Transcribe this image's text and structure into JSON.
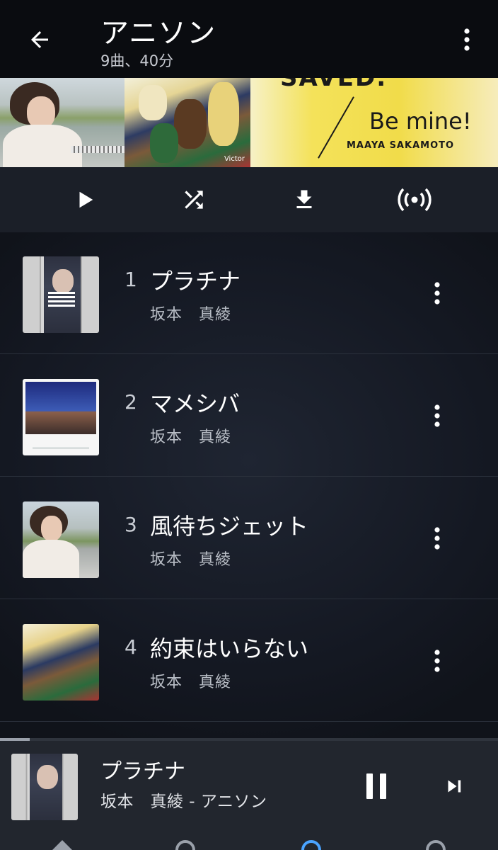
{
  "header": {
    "title": "アニソン",
    "subtitle": "9曲、40分",
    "back_icon": "arrow-left-icon",
    "menu_icon": "more-vertical-icon"
  },
  "art_strip": {
    "album3_title_partial": "SAVED.",
    "album3_subtitle": "Be mine!",
    "album3_artist": "MAAYA SAKAMOTO",
    "album2_label": "Victor"
  },
  "controls": {
    "play_icon": "play-icon",
    "shuffle_icon": "shuffle-icon",
    "download_icon": "download-icon",
    "radio_icon": "radio-broadcast-icon"
  },
  "tracks": [
    {
      "number": "1",
      "title": "プラチナ",
      "artist": "坂本　真綾"
    },
    {
      "number": "2",
      "title": "マメシバ",
      "artist": "坂本　真綾"
    },
    {
      "number": "3",
      "title": "風待ちジェット",
      "artist": "坂本　真綾"
    },
    {
      "number": "4",
      "title": "約束はいらない",
      "artist": "坂本　真綾"
    }
  ],
  "now_playing": {
    "title": "プラチナ",
    "subtitle": "坂本　真綾 - アニソン",
    "progress": 0.06,
    "pause_icon": "pause-icon",
    "next_icon": "skip-next-icon"
  },
  "colors": {
    "background": "#0e1117",
    "header": "#0a0c10",
    "controls_bar": "#1b1f28",
    "now_playing_bar": "#22262e",
    "accent": "#4aa3ff"
  }
}
